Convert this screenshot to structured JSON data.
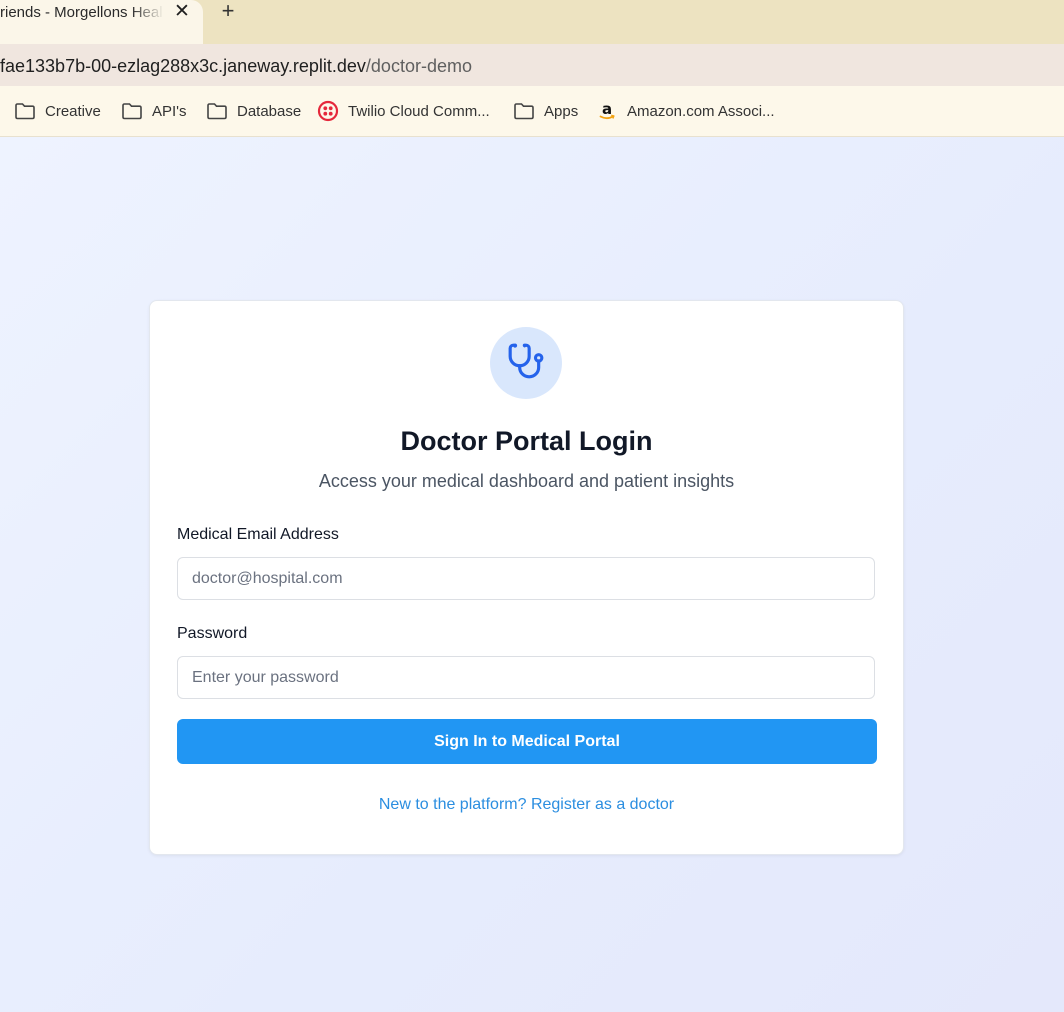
{
  "browser": {
    "tab": {
      "title": "riends - Morgellons Heal",
      "close_icon": "close-icon"
    },
    "new_tab_icon": "plus-icon",
    "address": {
      "host": "fae133b7b-00-ezlag288x3c.janeway.replit.dev",
      "path": "/doctor-demo"
    },
    "bookmarks": [
      {
        "label": "Creative",
        "icon": "folder-icon"
      },
      {
        "label": "API's",
        "icon": "folder-icon"
      },
      {
        "label": "Database",
        "icon": "folder-icon"
      },
      {
        "label": "Twilio Cloud Comm...",
        "icon": "twilio-icon"
      },
      {
        "label": "Apps",
        "icon": "folder-icon"
      },
      {
        "label": "Amazon.com Associ...",
        "icon": "amazon-icon"
      }
    ]
  },
  "login": {
    "logo_icon": "stethoscope-icon",
    "title": "Doctor Portal Login",
    "subtitle": "Access your medical dashboard and patient insights",
    "email": {
      "label": "Medical Email Address",
      "placeholder": "doctor@hospital.com",
      "value": ""
    },
    "password": {
      "label": "Password",
      "placeholder": "Enter your password",
      "value": ""
    },
    "submit_label": "Sign In to Medical Portal",
    "register_link": "New to the platform? Register as a doctor"
  },
  "colors": {
    "accent": "#2196f3",
    "link": "#2b8ee0",
    "logo_bg": "#d9e7fc",
    "logo_icon": "#2563eb",
    "tabstrip": "#ede3c1"
  }
}
